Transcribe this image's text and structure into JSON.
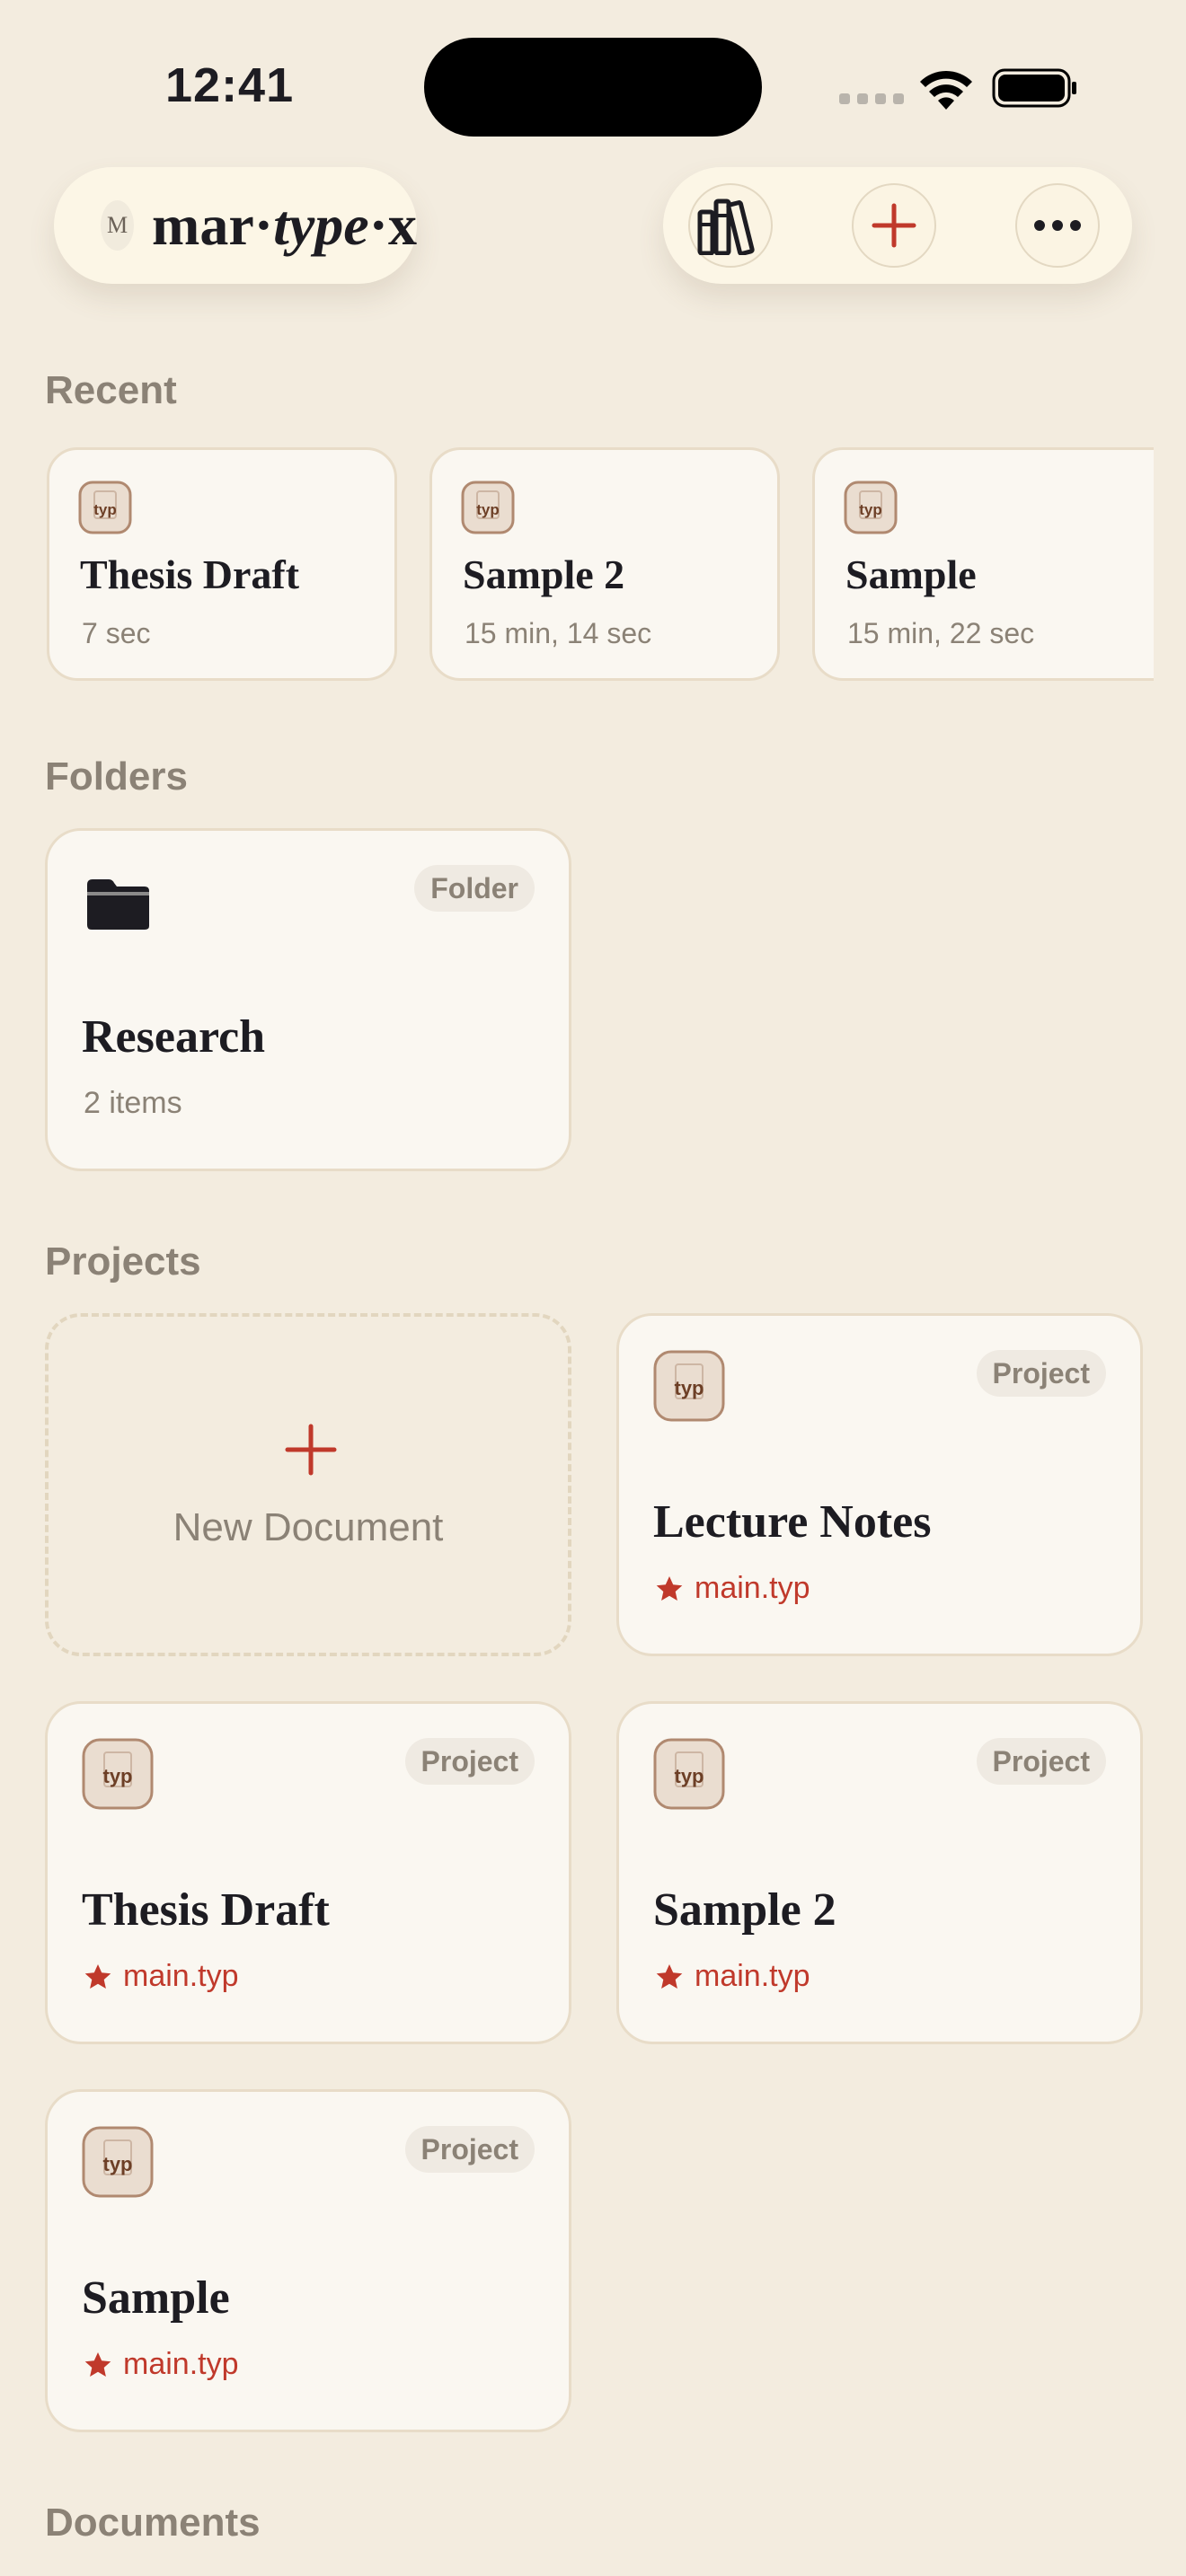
{
  "status": {
    "time": "12:41"
  },
  "header": {
    "logo_badge": "M",
    "logo_part1": "mar·",
    "logo_part2": "type",
    "logo_part3": "·x"
  },
  "sections": {
    "recent": "Recent",
    "folders": "Folders",
    "projects": "Projects",
    "documents": "Documents"
  },
  "recent": [
    {
      "title": "Thesis Draft",
      "meta": "7 sec",
      "icon_label": "typ"
    },
    {
      "title": "Sample 2",
      "meta": "15 min, 14 sec",
      "icon_label": "typ"
    },
    {
      "title": "Sample",
      "meta": "15 min, 22 sec",
      "icon_label": "typ"
    }
  ],
  "folders": [
    {
      "title": "Research",
      "meta": "2 items",
      "badge": "Folder"
    }
  ],
  "projects": {
    "new_label": "New Document",
    "items": [
      {
        "title": "Lecture Notes",
        "main_file": "main.typ",
        "badge": "Project",
        "icon_label": "typ"
      },
      {
        "title": "Thesis Draft",
        "main_file": "main.typ",
        "badge": "Project",
        "icon_label": "typ"
      },
      {
        "title": "Sample 2",
        "main_file": "main.typ",
        "badge": "Project",
        "icon_label": "typ"
      },
      {
        "title": "Sample",
        "main_file": "main.typ",
        "badge": "Project",
        "icon_label": "typ"
      }
    ]
  },
  "colors": {
    "background": "#f3ecdf",
    "accent": "#c0392b",
    "card": "#faf7f1",
    "muted": "#8b8276"
  }
}
